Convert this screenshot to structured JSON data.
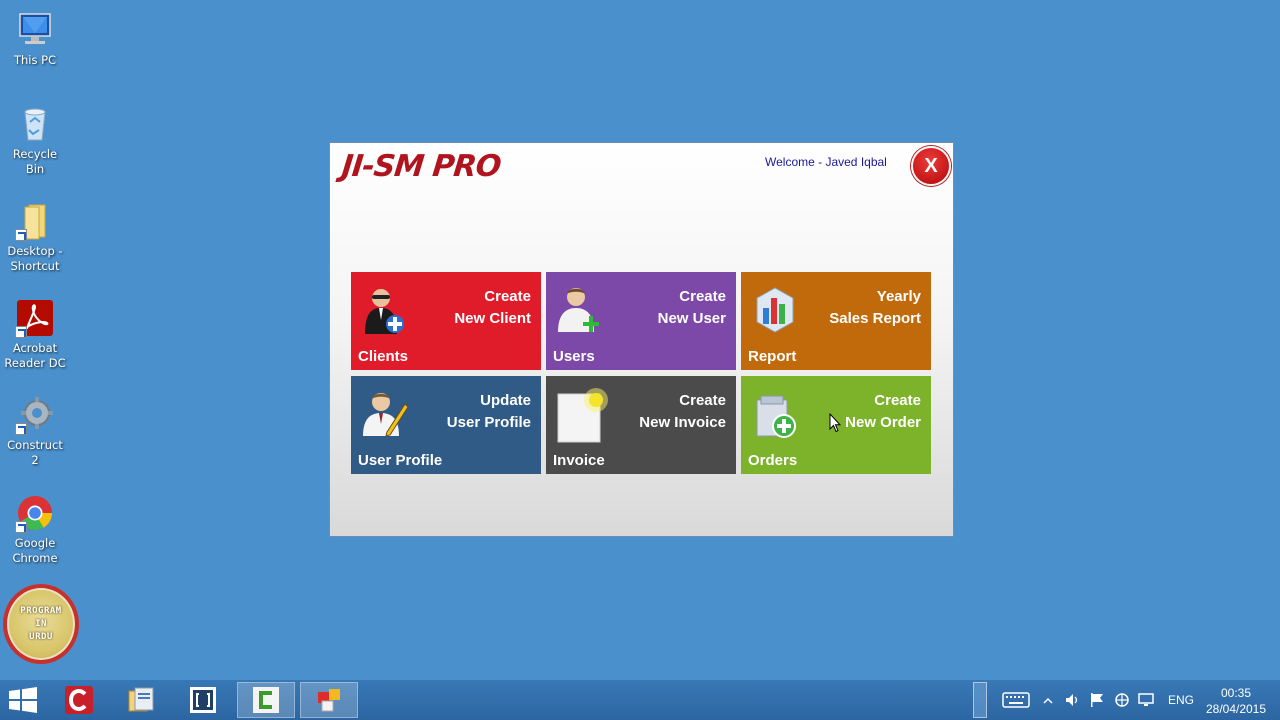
{
  "desktop": {
    "icons": [
      {
        "label": "This PC"
      },
      {
        "label": "Recycle Bin"
      },
      {
        "label": "Desktop - Shortcut"
      },
      {
        "label": "Acrobat Reader DC"
      },
      {
        "label": "Construct 2"
      },
      {
        "label": "Google Chrome"
      }
    ],
    "badge_text": "PROGRAM\nIN\nURDU"
  },
  "app": {
    "logo": "JI-SM PRO",
    "welcome": "Welcome - Javed Iqbal",
    "close_label": "X",
    "tiles": [
      {
        "title": "Clients",
        "action_line1": "Create",
        "action_line2": "New Client",
        "color": "#e01b2a",
        "icon": "add-client-icon"
      },
      {
        "title": "Users",
        "action_line1": "Create",
        "action_line2": "New User",
        "color": "#7d49a8",
        "icon": "add-user-icon"
      },
      {
        "title": "Report",
        "action_line1": "Yearly",
        "action_line2": "Sales Report",
        "color": "#c16a0c",
        "icon": "report-chart-icon"
      },
      {
        "title": "User Profile",
        "action_line1": "Update",
        "action_line2": "User Profile",
        "color": "#305b86",
        "icon": "edit-profile-icon"
      },
      {
        "title": "Invoice",
        "action_line1": "Create",
        "action_line2": "New Invoice",
        "color": "#4b4b4b",
        "icon": "invoice-icon"
      },
      {
        "title": "Orders",
        "action_line1": "Create",
        "action_line2": "New Order",
        "color": "#7cb32a",
        "icon": "add-order-icon"
      }
    ]
  },
  "taskbar": {
    "language": "ENG",
    "time": "00:35",
    "date": "28/04/2015"
  }
}
